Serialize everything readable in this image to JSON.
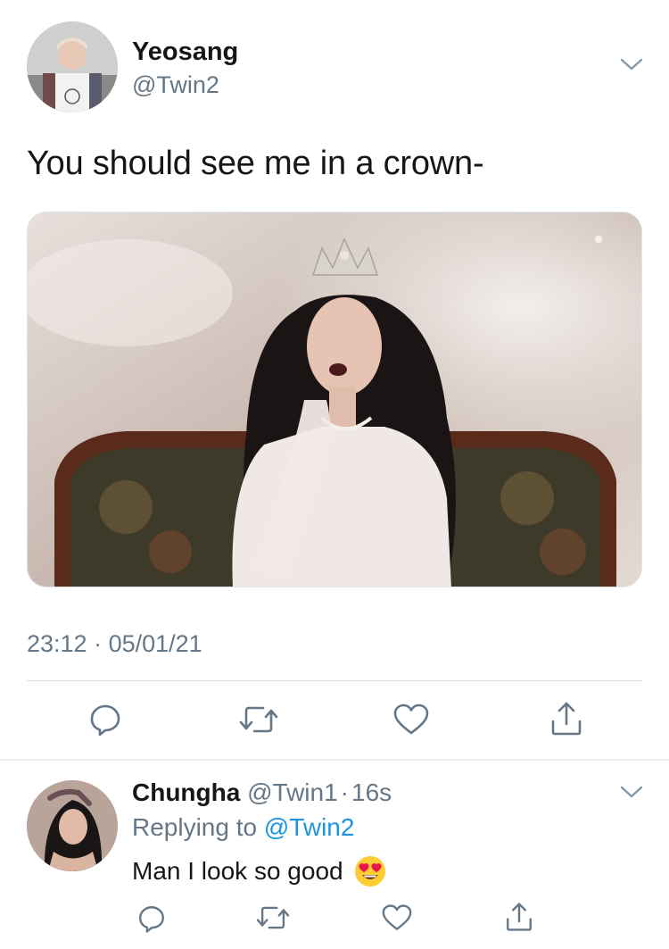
{
  "tweet": {
    "author_name": "Yeosang",
    "author_handle": "@Twin2",
    "text": "You should see me in a crown-",
    "time": "23:12",
    "separator": "·",
    "date": "05/01/21"
  },
  "reply": {
    "author_name": "Chungha",
    "author_handle": "@Twin1",
    "separator": "·",
    "time_ago": "16s",
    "replying_label": "Replying to",
    "replying_handle": "@Twin2",
    "text": "Man I look so good",
    "emoji": "heart-eyes-emoji"
  },
  "icons": {
    "reply": "reply-icon",
    "retweet": "retweet-icon",
    "like": "heart-icon",
    "share": "share-icon",
    "menu": "chevron-down-icon"
  },
  "colors": {
    "name": "#14171a",
    "secondary": "#657786",
    "link": "#1b95e0",
    "divider": "#e6ecf0"
  }
}
